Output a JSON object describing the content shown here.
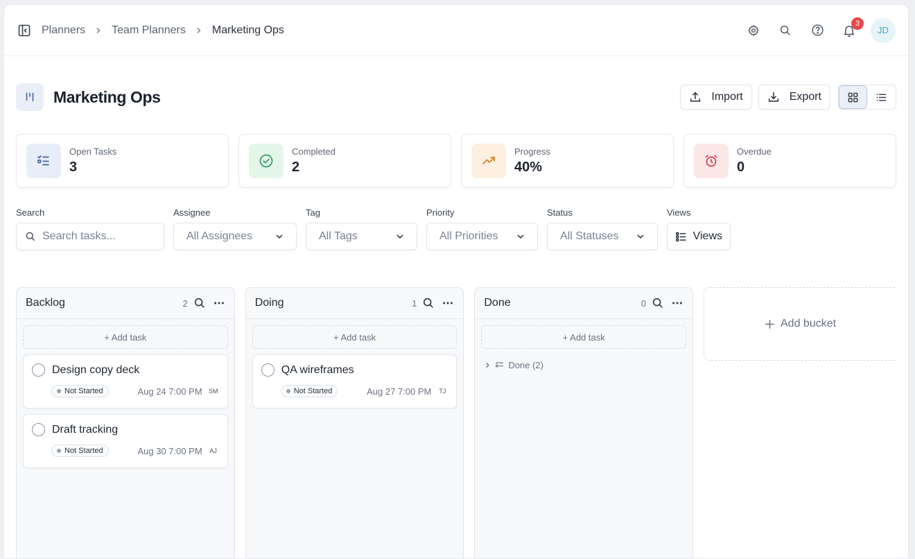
{
  "breadcrumb": [
    "Planners",
    "Team Planners",
    "Marketing Ops"
  ],
  "notifications": {
    "count": "3"
  },
  "user": {
    "initials": "JD"
  },
  "header": {
    "title": "Marketing Ops",
    "import_label": "Import",
    "export_label": "Export"
  },
  "stats": [
    {
      "label": "Open Tasks",
      "value": "3",
      "icon": "list-check-icon",
      "color": "#4763a0",
      "bg": "#e8eef9"
    },
    {
      "label": "Completed",
      "value": "2",
      "icon": "check-circle-icon",
      "color": "#2f9e5b",
      "bg": "#e4f6ea"
    },
    {
      "label": "Progress",
      "value": "40%",
      "icon": "trend-up-icon",
      "color": "#d9822b",
      "bg": "#fdf0e1"
    },
    {
      "label": "Overdue",
      "value": "0",
      "icon": "alarm-icon",
      "color": "#d6404a",
      "bg": "#fce7e8"
    }
  ],
  "filters": {
    "search": {
      "label": "Search",
      "placeholder": "Search tasks..."
    },
    "assignee": {
      "label": "Assignee",
      "value": "All Assignees"
    },
    "tag": {
      "label": "Tag",
      "value": "All Tags"
    },
    "priority": {
      "label": "Priority",
      "value": "All Priorities"
    },
    "status": {
      "label": "Status",
      "value": "All Statuses"
    },
    "views": {
      "label": "Views",
      "button": "Views"
    }
  },
  "buckets": [
    {
      "name": "Backlog",
      "count": "2",
      "add_task": "+ Add task",
      "tasks": [
        {
          "title": "Design copy deck",
          "status": "Not Started",
          "date": "Aug 24 7:00 PM",
          "initials": "SM"
        },
        {
          "title": "Draft tracking",
          "status": "Not Started",
          "date": "Aug 30 7:00 PM",
          "initials": "AJ"
        }
      ]
    },
    {
      "name": "Doing",
      "count": "1",
      "add_task": "+ Add task",
      "tasks": [
        {
          "title": "QA wireframes",
          "status": "Not Started",
          "date": "Aug 27 7:00 PM",
          "initials": "TJ"
        }
      ]
    },
    {
      "name": "Done",
      "count": "0",
      "add_task": "+ Add task",
      "completed_group": "Done (2)",
      "tasks": []
    }
  ],
  "add_bucket": "Add bucket"
}
